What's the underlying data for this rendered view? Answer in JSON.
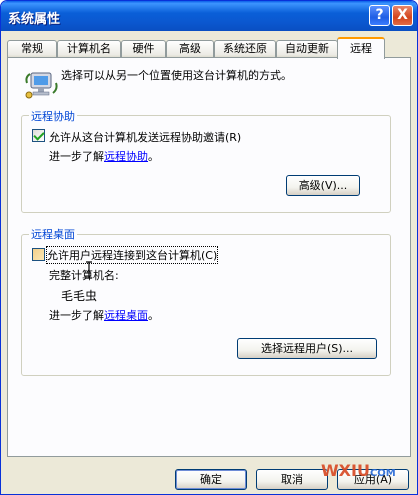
{
  "window": {
    "title": "系统属性",
    "help_button": "?",
    "close_button": "X"
  },
  "tabs": [
    "常规",
    "计算机名",
    "硬件",
    "高级",
    "系统还原",
    "自动更新",
    "远程"
  ],
  "active_tab": "远程",
  "intro": "选择可以从另一个位置使用这台计算机的方式。",
  "remote_assistance": {
    "group_title": "远程协助",
    "checkbox_label": "允许从这台计算机发送远程协助邀请(R)",
    "checked": true,
    "learn_more_prefix": "进一步了解",
    "learn_more_link": "远程协助",
    "learn_more_suffix": "。",
    "advanced_button": "高级(V)..."
  },
  "remote_desktop": {
    "group_title": "远程桌面",
    "checkbox_label": "允许用户远程连接到这台计算机(C)",
    "checked": false,
    "computer_name_label": "完整计算机名:",
    "computer_name": "毛毛虫",
    "learn_more_prefix": "进一步了解",
    "learn_more_link": "远程桌面",
    "learn_more_suffix": "。",
    "select_users_button": "选择远程用户(S)..."
  },
  "footer": {
    "ok": "确定",
    "cancel": "取消",
    "apply": "应用(A)"
  },
  "watermark": {
    "brand": "WXIU",
    "suffix": "COM"
  }
}
